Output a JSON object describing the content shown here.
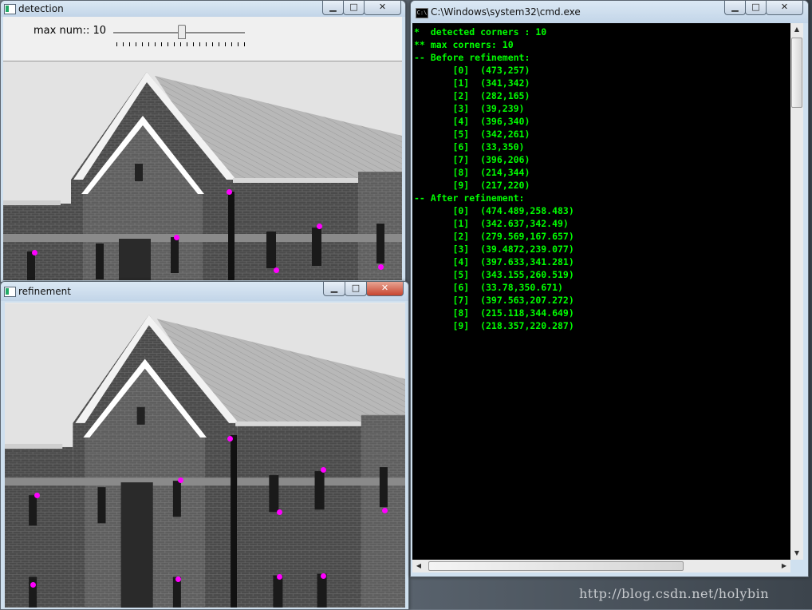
{
  "detection_window": {
    "title": "detection",
    "trackbar_label": "max num:: 10",
    "trackbar_value": 10
  },
  "refinement_window": {
    "title": "refinement"
  },
  "cmd_window": {
    "title": "C:\\Windows\\system32\\cmd.exe",
    "lines": [
      "*  detected corners : 10",
      "** max corners: 10",
      "-- Before refinement:",
      "       [0]  (473,257)",
      "       [1]  (341,342)",
      "       [2]  (282,165)",
      "       [3]  (39,239)",
      "       [4]  (396,340)",
      "       [5]  (342,261)",
      "       [6]  (33,350)",
      "       [7]  (396,206)",
      "       [8]  (214,344)",
      "       [9]  (217,220)",
      "-- After refinement:",
      "       [0]  (474.489,258.483)",
      "       [1]  (342.637,342.49)",
      "       [2]  (279.569,167.657)",
      "       [3]  (39.4872,239.077)",
      "       [4]  (397.633,341.281)",
      "       [5]  (343.155,260.519)",
      "       [6]  (33.78,350.671)",
      "       [7]  (397.563,207.272)",
      "       [8]  (215.118,344.649)",
      "       [9]  (218.357,220.287)"
    ]
  },
  "window_controls": {
    "minimize": "▁",
    "maximize": "□",
    "close": "✕"
  },
  "watermark": "http://blog.csdn.net/holybin",
  "colors": {
    "corner_marker": "#ff00ff",
    "console_text": "#00ff00",
    "console_bg": "#000000"
  }
}
